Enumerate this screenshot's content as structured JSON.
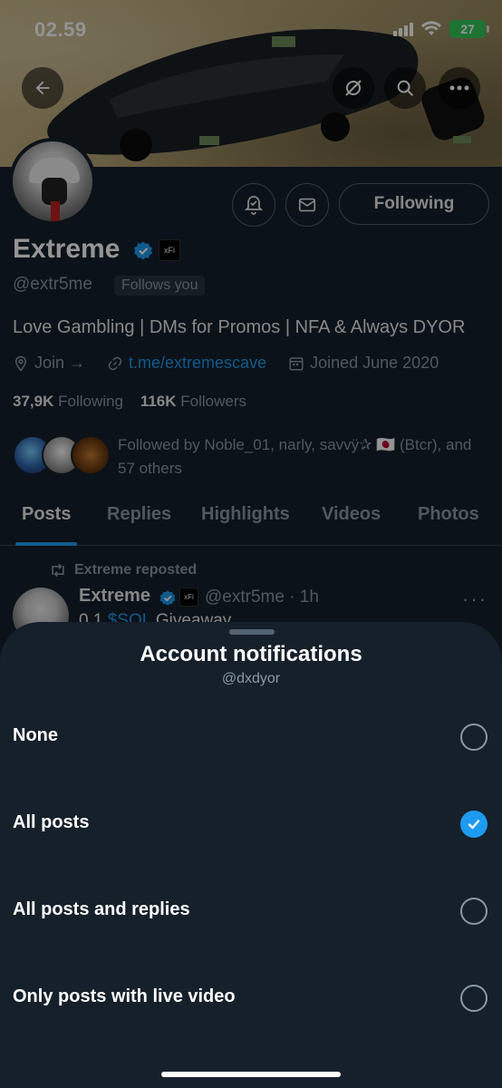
{
  "status_bar": {
    "time": "02.59",
    "battery": "27"
  },
  "profile": {
    "display_name": "Extreme",
    "org_badge": "xFi",
    "handle": "@extr5me",
    "follows_you": "Follows you",
    "bio": "Love Gambling | DMs for Promos | NFA & Always DYOR",
    "join_link_label": "Join →",
    "link": "t.me/extremescave",
    "joined": "Joined June 2020",
    "following_count": "37,9K",
    "following_label": "Following",
    "followers_count": "116K",
    "followers_label": "Followers",
    "followed_by": "Followed by Noble_01, narly, savvÿ✰ 🇯🇵 (Btcr), and 57 others",
    "following_button": "Following"
  },
  "tabs": [
    "Posts",
    "Replies",
    "Highlights",
    "Videos",
    "Photos"
  ],
  "post": {
    "repost_label": "Extreme reposted",
    "name": "Extreme",
    "org_badge": "xFi",
    "handle_time": "@extr5me · 1h",
    "text_prefix": "0.1 ",
    "cashtag": "$SOL",
    "text_suffix": " Giveaway"
  },
  "sheet": {
    "title": "Account notifications",
    "subtitle": "@dxdyor",
    "options": [
      {
        "label": "None",
        "checked": false
      },
      {
        "label": "All posts",
        "checked": true
      },
      {
        "label": "All posts and replies",
        "checked": false
      },
      {
        "label": "Only posts with live video",
        "checked": false
      }
    ]
  },
  "colors": {
    "accent": "#1d9bf0",
    "background": "#15202b",
    "battery": "#34c759"
  }
}
